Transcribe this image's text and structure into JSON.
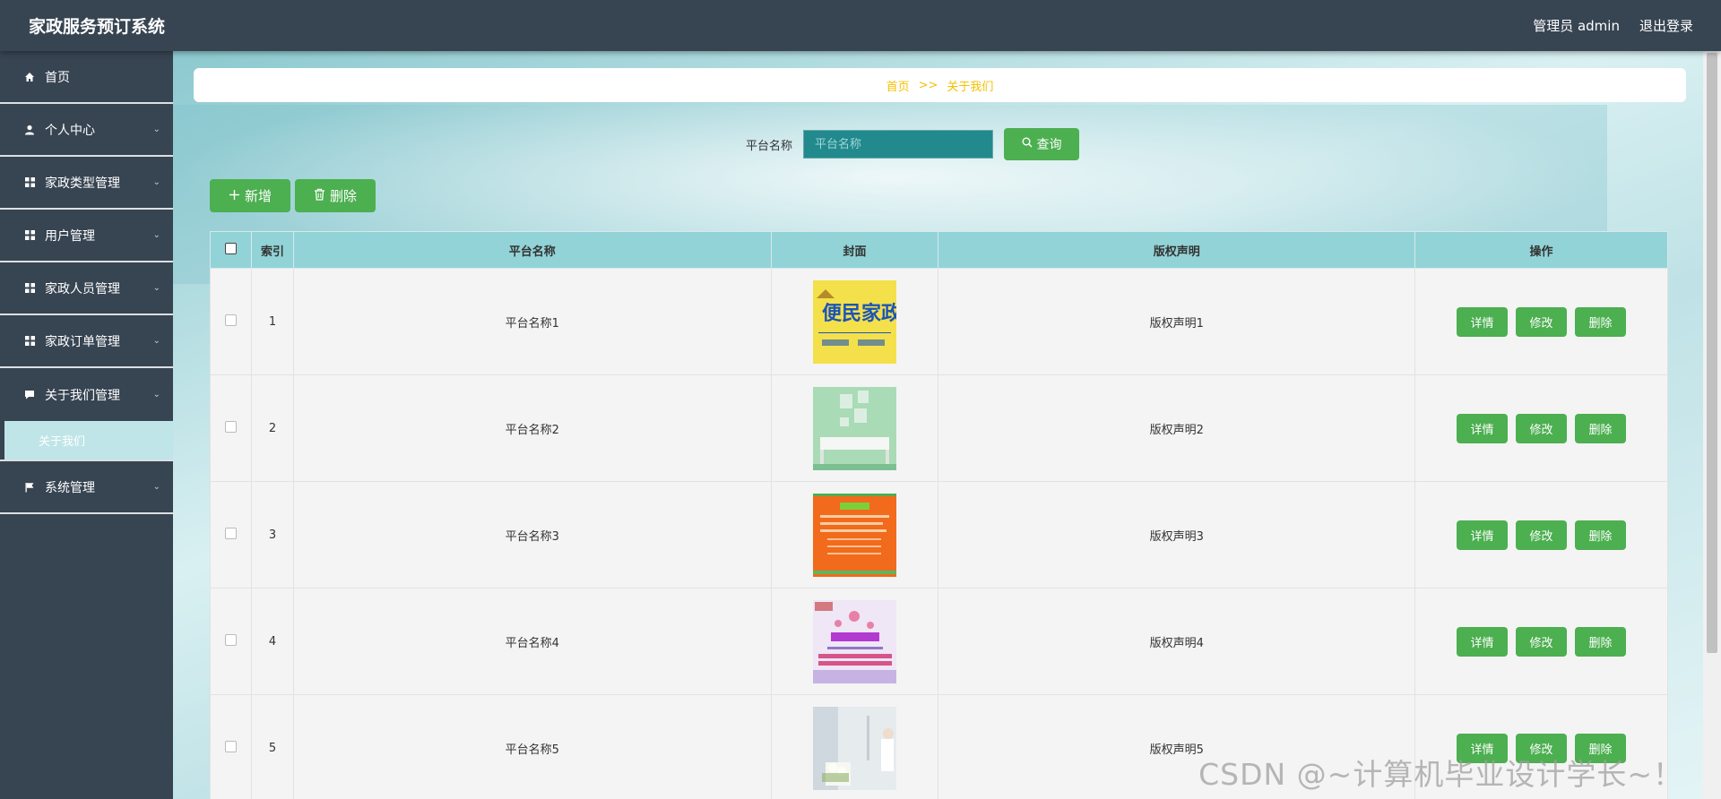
{
  "app": {
    "title": "家政服务预订系统",
    "user_label": "管理员 admin",
    "logout_label": "退出登录"
  },
  "sidebar": {
    "items": [
      {
        "label": "首页",
        "icon": "home-icon",
        "has_children": false
      },
      {
        "label": "个人中心",
        "icon": "person-icon",
        "has_children": true
      },
      {
        "label": "家政类型管理",
        "icon": "grid-icon",
        "has_children": true
      },
      {
        "label": "用户管理",
        "icon": "grid-icon",
        "has_children": true
      },
      {
        "label": "家政人员管理",
        "icon": "grid-icon",
        "has_children": true
      },
      {
        "label": "家政订单管理",
        "icon": "grid-icon",
        "has_children": true
      },
      {
        "label": "关于我们管理",
        "icon": "chat-icon",
        "has_children": true
      },
      {
        "label": "系统管理",
        "icon": "flag-icon",
        "has_children": true
      }
    ],
    "active_submenu": "关于我们"
  },
  "breadcrumb": {
    "home": "首页",
    "separator": ">>",
    "current": "关于我们"
  },
  "search": {
    "label": "平台名称",
    "placeholder": "平台名称",
    "button_label": "查询"
  },
  "actions": {
    "add_label": "新增",
    "delete_label": "删除"
  },
  "table": {
    "columns": [
      "索引",
      "平台名称",
      "封面",
      "版权声明",
      "操作"
    ],
    "rows": [
      {
        "index": "1",
        "name": "平台名称1",
        "cover_text": "便民家政",
        "copyright": "版权声明1"
      },
      {
        "index": "2",
        "name": "平台名称2",
        "cover_text": "",
        "copyright": "版权声明2"
      },
      {
        "index": "3",
        "name": "平台名称3",
        "cover_text": "",
        "copyright": "版权声明3"
      },
      {
        "index": "4",
        "name": "平台名称4",
        "cover_text": "",
        "copyright": "版权声明4"
      },
      {
        "index": "5",
        "name": "平台名称5",
        "cover_text": "",
        "copyright": "版权声明5"
      }
    ],
    "row_buttons": {
      "detail": "详情",
      "edit": "修改",
      "delete": "删除"
    }
  },
  "watermark": "CSDN @~计算机毕业设计学长~！",
  "colors": {
    "topbar": "#374452",
    "accent_green": "#4caf50",
    "table_header": "#92d3d7",
    "breadcrumb_text": "#f5c000",
    "search_input": "#22898d"
  }
}
